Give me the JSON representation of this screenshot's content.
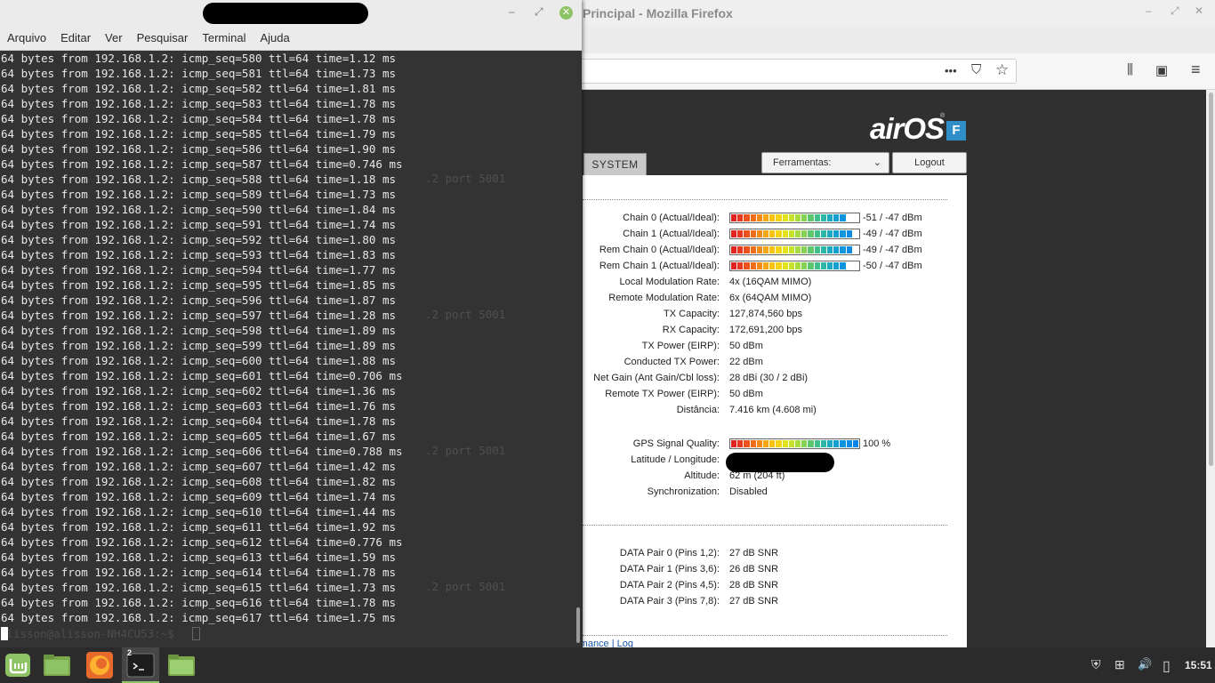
{
  "firefox": {
    "title": "Principal - Mozilla Firefox",
    "ctrl_min": "–",
    "ctrl_max": "⤢",
    "ctrl_close": "✕",
    "page_menu_icon": "•••",
    "pocket_icon": "⛉",
    "star_icon": "☆",
    "library_icon": "⫼",
    "sidebar_icon": "▣",
    "menu_icon": "≡"
  },
  "airos": {
    "logo": "airOS",
    "logo_reg": "®",
    "badge": "F",
    "tab_system": "SYSTEM",
    "tools_select": "Ferramentas:",
    "tools_chevron": "⌄",
    "logout": "Logout",
    "chains": [
      {
        "label": "Chain 0 (Actual/Ideal):",
        "value": "-51 / -47 dBm",
        "level": 0.92
      },
      {
        "label": "Chain 1 (Actual/Ideal):",
        "value": "-49 / -47 dBm",
        "level": 0.96
      },
      {
        "label": "Rem Chain 0 (Actual/Ideal):",
        "value": "-49 / -47 dBm",
        "level": 0.96
      },
      {
        "label": "Rem Chain 1 (Actual/Ideal):",
        "value": "-50 / -47 dBm",
        "level": 0.92
      }
    ],
    "info": [
      {
        "label": "Local Modulation Rate:",
        "value": "4x (16QAM MIMO)"
      },
      {
        "label": "Remote Modulation Rate:",
        "value": "6x (64QAM MIMO)"
      },
      {
        "label": "TX Capacity:",
        "value": "127,874,560 bps"
      },
      {
        "label": "RX Capacity:",
        "value": "172,691,200 bps"
      },
      {
        "label": "TX Power (EIRP):",
        "value": "50 dBm"
      },
      {
        "label": "Conducted TX Power:",
        "value": "22 dBm"
      },
      {
        "label": "Net Gain (Ant Gain/Cbl loss):",
        "value": "28 dBi (30 / 2 dBi)"
      },
      {
        "label": "Remote TX Power (EIRP):",
        "value": "50 dBm"
      },
      {
        "label": "Distância:",
        "value": "7.416 km (4.608 mi)"
      }
    ],
    "gps": {
      "label": "GPS Signal Quality:",
      "value": "100 %",
      "level": 1.0
    },
    "gps_info": [
      {
        "label": "Latitude / Longitude:",
        "value": ""
      },
      {
        "label": "Altitude:",
        "value": "62 m (204 ft)"
      },
      {
        "label": "Synchronization:",
        "value": "Disabled"
      }
    ],
    "data_pairs": [
      {
        "label": "DATA Pair 0 (Pins 1,2):",
        "value": "27 dB SNR"
      },
      {
        "label": "DATA Pair 1 (Pins 3,6):",
        "value": "26 dB SNR"
      },
      {
        "label": "DATA Pair 2 (Pins 4,5):",
        "value": "28 dB SNR"
      },
      {
        "label": "DATA Pair 3 (Pins 7,8):",
        "value": "27 dB SNR"
      }
    ],
    "footer": "rmance | Log"
  },
  "terminal": {
    "ctrl_min": "–",
    "ctrl_max": "⤢",
    "ctrl_close": "✕",
    "menu": [
      "Arquivo",
      "Editar",
      "Ver",
      "Pesquisar",
      "Terminal",
      "Ajuda"
    ],
    "lines": [
      "64 bytes from 192.168.1.2: icmp_seq=580 ttl=64 time=1.12 ms",
      "64 bytes from 192.168.1.2: icmp_seq=581 ttl=64 time=1.73 ms",
      "64 bytes from 192.168.1.2: icmp_seq=582 ttl=64 time=1.81 ms",
      "64 bytes from 192.168.1.2: icmp_seq=583 ttl=64 time=1.78 ms",
      "64 bytes from 192.168.1.2: icmp_seq=584 ttl=64 time=1.78 ms",
      "64 bytes from 192.168.1.2: icmp_seq=585 ttl=64 time=1.79 ms",
      "64 bytes from 192.168.1.2: icmp_seq=586 ttl=64 time=1.90 ms",
      "64 bytes from 192.168.1.2: icmp_seq=587 ttl=64 time=0.746 ms",
      "64 bytes from 192.168.1.2: icmp_seq=588 ttl=64 time=1.18 ms",
      "64 bytes from 192.168.1.2: icmp_seq=589 ttl=64 time=1.73 ms",
      "64 bytes from 192.168.1.2: icmp_seq=590 ttl=64 time=1.84 ms",
      "64 bytes from 192.168.1.2: icmp_seq=591 ttl=64 time=1.74 ms",
      "64 bytes from 192.168.1.2: icmp_seq=592 ttl=64 time=1.80 ms",
      "64 bytes from 192.168.1.2: icmp_seq=593 ttl=64 time=1.83 ms",
      "64 bytes from 192.168.1.2: icmp_seq=594 ttl=64 time=1.77 ms",
      "64 bytes from 192.168.1.2: icmp_seq=595 ttl=64 time=1.85 ms",
      "64 bytes from 192.168.1.2: icmp_seq=596 ttl=64 time=1.87 ms",
      "64 bytes from 192.168.1.2: icmp_seq=597 ttl=64 time=1.28 ms",
      "64 bytes from 192.168.1.2: icmp_seq=598 ttl=64 time=1.89 ms",
      "64 bytes from 192.168.1.2: icmp_seq=599 ttl=64 time=1.89 ms",
      "64 bytes from 192.168.1.2: icmp_seq=600 ttl=64 time=1.88 ms",
      "64 bytes from 192.168.1.2: icmp_seq=601 ttl=64 time=0.706 ms",
      "64 bytes from 192.168.1.2: icmp_seq=602 ttl=64 time=1.36 ms",
      "64 bytes from 192.168.1.2: icmp_seq=603 ttl=64 time=1.76 ms",
      "64 bytes from 192.168.1.2: icmp_seq=604 ttl=64 time=1.78 ms",
      "64 bytes from 192.168.1.2: icmp_seq=605 ttl=64 time=1.67 ms",
      "64 bytes from 192.168.1.2: icmp_seq=606 ttl=64 time=0.788 ms",
      "64 bytes from 192.168.1.2: icmp_seq=607 ttl=64 time=1.42 ms",
      "64 bytes from 192.168.1.2: icmp_seq=608 ttl=64 time=1.82 ms",
      "64 bytes from 192.168.1.2: icmp_seq=609 ttl=64 time=1.74 ms",
      "64 bytes from 192.168.1.2: icmp_seq=610 ttl=64 time=1.44 ms",
      "64 bytes from 192.168.1.2: icmp_seq=611 ttl=64 time=1.92 ms",
      "64 bytes from 192.168.1.2: icmp_seq=612 ttl=64 time=0.776 ms",
      "64 bytes from 192.168.1.2: icmp_seq=613 ttl=64 time=1.59 ms",
      "64 bytes from 192.168.1.2: icmp_seq=614 ttl=64 time=1.78 ms",
      "64 bytes from 192.168.1.2: icmp_seq=615 ttl=64 time=1.73 ms",
      "64 bytes from 192.168.1.2: icmp_seq=616 ttl=64 time=1.78 ms",
      "64 bytes from 192.168.1.2: icmp_seq=617 ttl=64 time=1.75 ms"
    ],
    "ghost_text": ".2 port 5001",
    "prompt": "alisson@alisson-NH4CU53:~$ "
  },
  "taskbar": {
    "active_badge": "2",
    "terminal_glyph": ">_",
    "clock": "15:51",
    "icons": [
      "mint-menu-icon",
      "files-icon",
      "firefox-icon",
      "terminal-icon",
      "folder-icon"
    ],
    "tray_shield": "⛨",
    "tray_network": "⊞",
    "tray_volume": "🔊",
    "tray_battery": "▯"
  }
}
